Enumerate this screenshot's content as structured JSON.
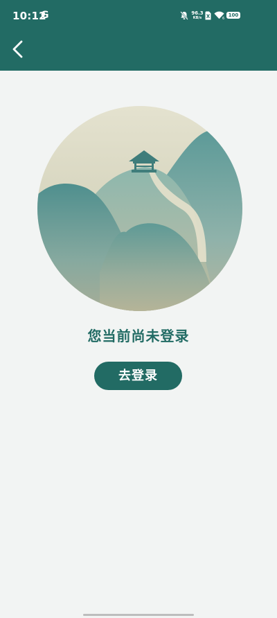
{
  "status_bar": {
    "time": "10:12",
    "carrier_icon_letter": "G",
    "net_speed_value": "96.3",
    "net_speed_unit": "KB/s",
    "battery": "100",
    "icons": [
      "mute-bell-icon",
      "no-sim-icon",
      "wifi-icon",
      "battery-icon"
    ]
  },
  "header": {
    "back_icon": "chevron-left-icon"
  },
  "main": {
    "illustration": "mountain-pavilion-illustration",
    "message": "您当前尚未登录",
    "login_button_label": "去登录"
  },
  "colors": {
    "primary": "#226b64",
    "background": "#f2f4f3",
    "text_on_primary": "#ffffff"
  }
}
